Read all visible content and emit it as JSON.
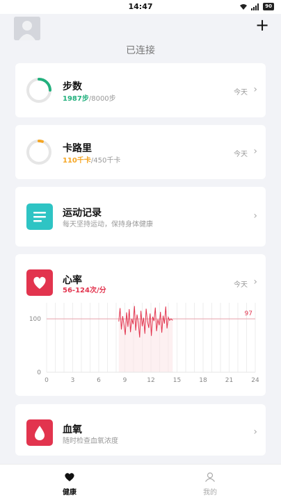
{
  "status_bar": {
    "time": "14:47",
    "battery": "90"
  },
  "header": {
    "connection_status": "已连接",
    "add_label": "+"
  },
  "steps": {
    "title": "步数",
    "current": "1987步",
    "goal": "/8000步",
    "period": "今天",
    "progress": 0.248,
    "accent_color": "#22b07d"
  },
  "calories": {
    "title": "卡路里",
    "current": "110千卡",
    "goal": "/450千卡",
    "period": "今天",
    "progress": 0.05,
    "accent_color": "#f5a623"
  },
  "exercise": {
    "title": "运动记录",
    "subtitle": "每天坚持运动，保持身体健康",
    "accent_color": "#2ec4c4"
  },
  "heart_rate": {
    "title": "心率",
    "range": "56-124次/分",
    "period": "今天",
    "accent_color": "#e2344e"
  },
  "blood_oxygen": {
    "title": "血氧",
    "subtitle": "随时检查血氧浓度",
    "accent_color": "#e2344e"
  },
  "nav": {
    "health": "健康",
    "mine": "我的"
  },
  "chart_data": {
    "type": "line",
    "xlabel": "",
    "ylabel": "",
    "xlim": [
      0,
      24
    ],
    "ylim": [
      0,
      130
    ],
    "x_ticks": [
      0,
      3,
      6,
      9,
      12,
      15,
      18,
      21,
      24
    ],
    "y_ticks": [
      0,
      100
    ],
    "reference_line": {
      "value": 100
    },
    "end_label": "97",
    "series": [
      {
        "x": [
          8.3,
          8.45,
          8.6,
          8.75,
          8.9,
          9.05,
          9.2,
          9.35,
          9.5,
          9.65,
          9.8,
          9.95,
          10.1,
          10.25,
          10.4,
          10.55,
          10.7,
          10.85,
          11.0,
          11.15,
          11.3,
          11.45,
          11.6,
          11.75,
          11.9,
          12.05,
          12.2,
          12.35,
          12.5,
          12.65,
          12.8,
          12.95,
          13.1,
          13.25,
          13.4,
          13.55,
          13.7,
          13.85,
          14.0,
          14.15,
          14.3,
          14.5
        ],
        "y": [
          95,
          120,
          80,
          105,
          88,
          70,
          112,
          85,
          118,
          75,
          100,
          90,
          124,
          78,
          108,
          92,
          65,
          115,
          86,
          102,
          72,
          119,
          95,
          83,
          110,
          68,
          104,
          96,
          121,
          77,
          99,
          88,
          113,
          74,
          106,
          91,
          123,
          82,
          103,
          97,
          100,
          97
        ]
      }
    ]
  }
}
